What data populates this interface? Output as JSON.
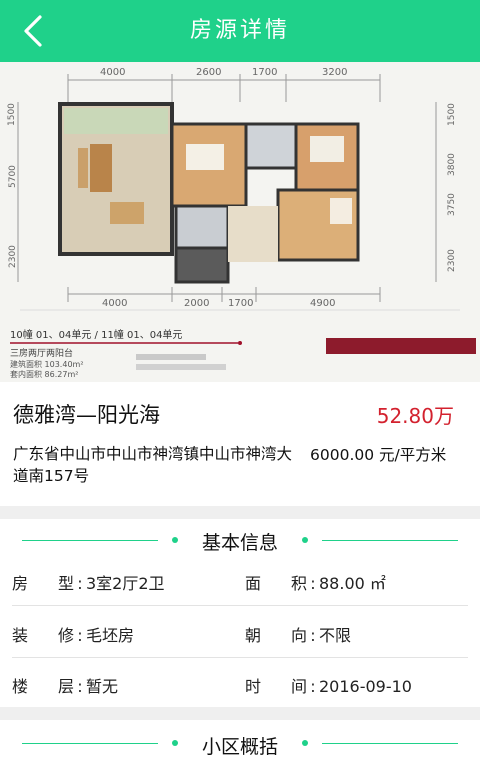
{
  "header": {
    "title": "房源详情"
  },
  "plan": {
    "top_dims": [
      "4000",
      "2600",
      "1700",
      "3200"
    ],
    "bottom_dims": [
      "4000",
      "2000",
      "1700",
      "4900"
    ],
    "left_dims": [
      "1500",
      "5700",
      "2300"
    ],
    "right_dims": [
      "1500",
      "3800",
      "3750",
      "2300"
    ],
    "caption_line1": "10幢 01、04单元 / 11幢 01、04单元",
    "caption_line2": "三房两厅两阳台",
    "caption_line3": "建筑面积 103.40m²",
    "caption_line4": "套内面积 86.27m²"
  },
  "property": {
    "name": "德雅湾—阳光海",
    "price": "52.80万",
    "address": "广东省中山市中山市神湾镇中山市神湾大道南157号",
    "unit_price": "6000.00 元/平方米"
  },
  "basic_info": {
    "title": "基本信息",
    "layout_label": "房　型",
    "layout_value": "3室2厅2卫",
    "area_label": "面　积",
    "area_value": "88.00 ㎡",
    "decoration_label": "装　修",
    "decoration_value": "毛坯房",
    "orientation_label": "朝　向",
    "orientation_value": "不限",
    "floor_label": "楼　层",
    "floor_value": "暂无",
    "time_label": "时　间",
    "time_value": "2016-09-10"
  },
  "community": {
    "title": "小区概括"
  },
  "colors": {
    "accent": "#1fd18a",
    "price": "#d3212e"
  }
}
